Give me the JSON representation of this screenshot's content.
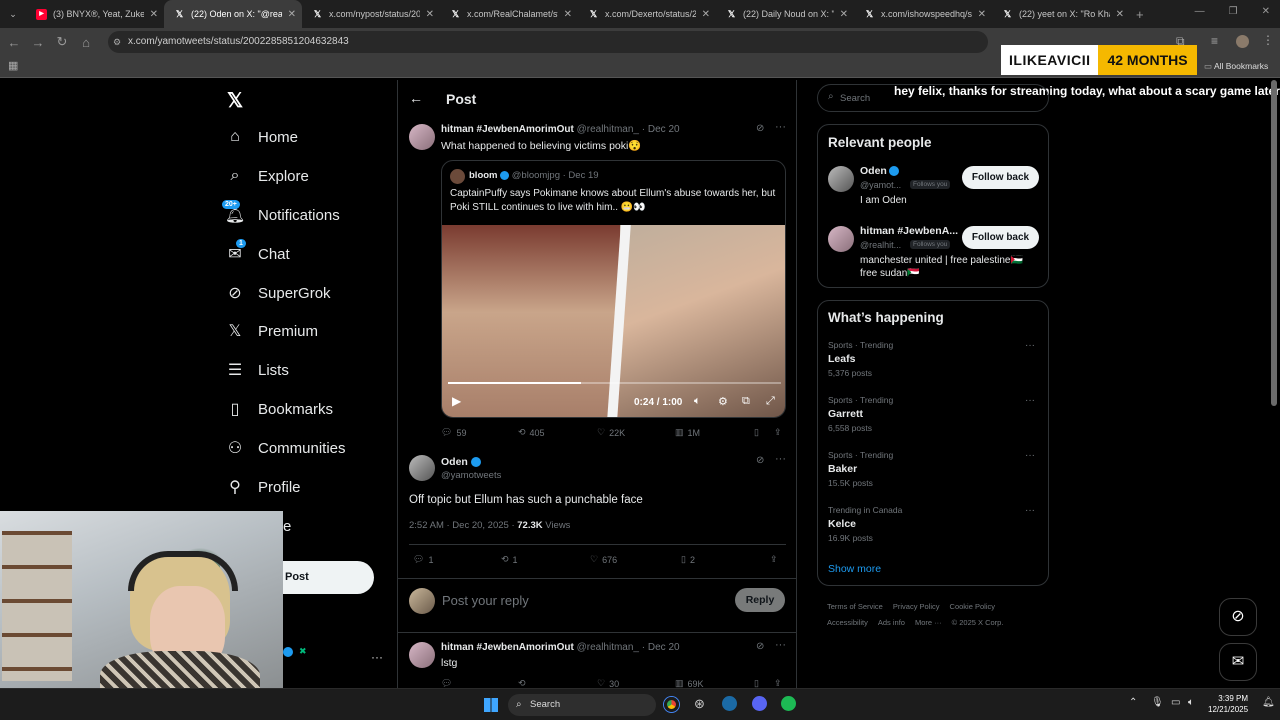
{
  "browser": {
    "tabs": [
      {
        "title": "(3) BNYX®, Yeat, Zukenee",
        "icon": "youtube-icon",
        "color": "#ff0033"
      },
      {
        "title": "(22) Oden on X: \"@realhi",
        "icon": "x-icon",
        "color": "#000000",
        "active": true
      },
      {
        "title": "x.com/nypost/status/200",
        "icon": "x-icon",
        "color": "#000000"
      },
      {
        "title": "x.com/RealChalamet/statu",
        "icon": "x-icon",
        "color": "#000000"
      },
      {
        "title": "x.com/Dexerto/status/20",
        "icon": "x-icon",
        "color": "#000000"
      },
      {
        "title": "(22) Daily Noud on X: \"Je",
        "icon": "x-icon",
        "color": "#000000"
      },
      {
        "title": "x.com/ishowspeedhq/stat",
        "icon": "x-icon",
        "color": "#000000"
      },
      {
        "title": "(22) yeet on X: \"Ro Khann",
        "icon": "x-icon",
        "color": "#000000"
      }
    ],
    "url": "x.com/yamotweets/status/2002285851204632843",
    "all_bookmarks": "All Bookmarks"
  },
  "overlay": {
    "sub_name": "ILIKEAVICII",
    "sub_months": "42 MONTHS",
    "message": "hey felix, thanks for streaming today, what about a scary game later?"
  },
  "nav": {
    "items": [
      {
        "label": "Home",
        "icon": "home-icon"
      },
      {
        "label": "Explore",
        "icon": "search-icon"
      },
      {
        "label": "Notifications",
        "icon": "bell-icon",
        "badge": "20+"
      },
      {
        "label": "Chat",
        "icon": "mail-icon",
        "badge": "1"
      },
      {
        "label": "SuperGrok",
        "icon": "grok-icon"
      },
      {
        "label": "Premium",
        "icon": "x-logo-icon"
      },
      {
        "label": "Lists",
        "icon": "list-icon"
      },
      {
        "label": "Bookmarks",
        "icon": "bookmark-icon"
      },
      {
        "label": "Communities",
        "icon": "people-icon"
      },
      {
        "label": "Profile",
        "icon": "person-icon"
      },
      {
        "label": "e",
        "icon": "more-icon"
      }
    ],
    "post_button": "Post"
  },
  "header": {
    "title": "Post"
  },
  "parent_post": {
    "name": "hitman #JewbenAmorimOut",
    "handle": "@realhitman_",
    "date": "· Dec 20",
    "text": "What happened to believing victims poki😯",
    "quote": {
      "name": "bloom",
      "handle": "@bloomjpg",
      "date": "· Dec 19",
      "text": "CaptainPuffy says Pokimane knows about Ellum's abuse towards her, but Poki STILL continues to live with him.. 😬👀",
      "video_time": "0:24 / 1:00",
      "video_progress": 0.4
    },
    "stats": {
      "replies": "59",
      "reposts": "405",
      "likes": "22K",
      "views": "1M"
    }
  },
  "main_post": {
    "name": "Oden",
    "handle": "@yamotweets",
    "text": "Off topic but Ellum has such a punchable face",
    "time": "2:52 AM · Dec 20, 2025 · ",
    "views_count": "72.3K",
    "views_label": " Views",
    "stats": {
      "replies": "1",
      "reposts": "1",
      "likes": "676",
      "bookmarks": "2"
    }
  },
  "reply_box": {
    "placeholder": "Post your reply",
    "button": "Reply"
  },
  "reply_post": {
    "name": "hitman #JewbenAmorimOut",
    "handle": "@realhitman_",
    "date": "· Dec 20",
    "text": "lstg",
    "stats": {
      "replies": "",
      "reposts": "",
      "likes": "30",
      "views": "69K"
    }
  },
  "right": {
    "search_placeholder": "Search",
    "relevant_title": "Relevant people",
    "people": [
      {
        "name": "Oden",
        "handle": "@yamot...",
        "follows": "Follows you",
        "bio": "I am Oden",
        "button": "Follow back"
      },
      {
        "name": "hitman #JewbenA...",
        "handle": "@realhit...",
        "follows": "Follows you",
        "bio": "manchester united | free palestine🇵🇸 free sudan🇸🇩",
        "button": "Follow back"
      }
    ],
    "happening_title": "What’s happening",
    "trends": [
      {
        "cat": "Sports · Trending",
        "topic": "Leafs",
        "posts": "5,376 posts"
      },
      {
        "cat": "Sports · Trending",
        "topic": "Garrett",
        "posts": "6,558 posts"
      },
      {
        "cat": "Sports · Trending",
        "topic": "Baker",
        "posts": "15.5K posts"
      },
      {
        "cat": "Trending in Canada",
        "topic": "Kelce",
        "posts": "16.9K posts"
      }
    ],
    "show_more": "Show more",
    "footer_links": [
      "Terms of Service",
      "Privacy Policy",
      "Cookie Policy",
      "Accessibility",
      "Ads info",
      "More ···",
      "© 2025 X Corp."
    ]
  },
  "taskbar": {
    "search": "Search",
    "time": "3:39 PM",
    "date": "12/21/2025"
  }
}
